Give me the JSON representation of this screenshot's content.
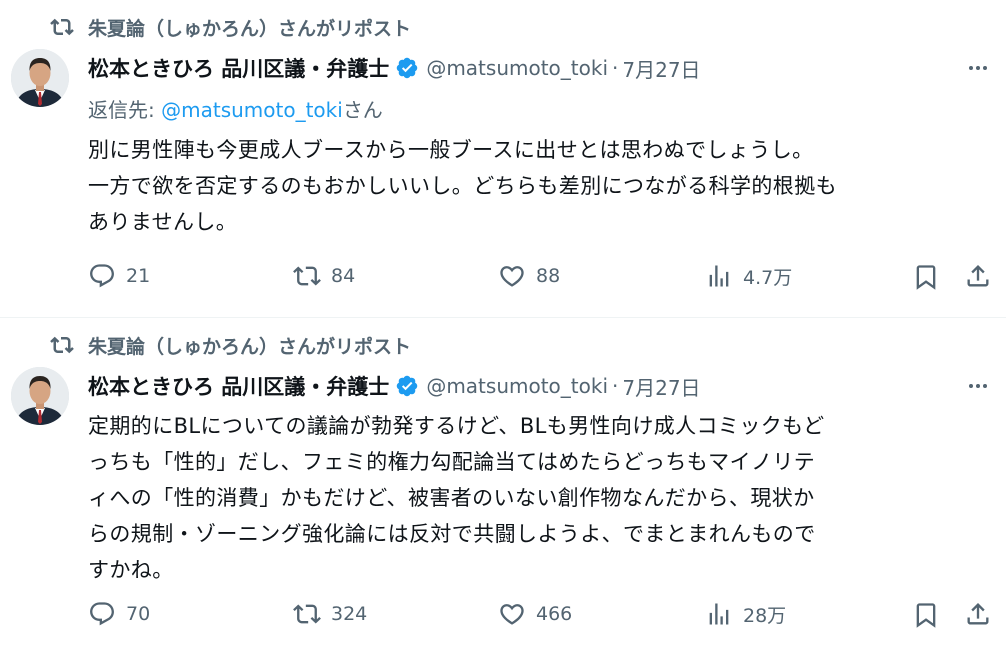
{
  "colors": {
    "accent": "#1d9bf0",
    "text": "#0f1419",
    "muted": "#536471",
    "divider": "#eff3f4"
  },
  "icons": {
    "repost": "repost-icon",
    "verified": "verified-badge-icon",
    "more": "more-icon",
    "reply": "reply-icon",
    "like": "like-icon",
    "views": "views-icon",
    "bookmark": "bookmark-icon",
    "share": "share-icon"
  },
  "tweets": [
    {
      "repost_label": "朱夏論（しゅかろん）さんがリポスト",
      "author_name": "松本ときひろ 品川区議・弁護士",
      "handle": "@matsumoto_toki",
      "separator": "·",
      "date": "7月27日",
      "reply_prefix": "返信先: ",
      "reply_handle": "@matsumoto_toki",
      "reply_suffix": "さん",
      "lines": [
        "別に男性陣も今更成人ブースから一般ブースに出せとは思わぬでしょうし。",
        "一方で欲を否定するのもおかしいいし。どちらも差別につながる科学的根拠も",
        "ありませんし。"
      ],
      "replies": "21",
      "reposts": "84",
      "likes": "88",
      "views": "4.7万"
    },
    {
      "repost_label": "朱夏論（しゅかろん）さんがリポスト",
      "author_name": "松本ときひろ 品川区議・弁護士",
      "handle": "@matsumoto_toki",
      "separator": "·",
      "date": "7月27日",
      "lines": [
        "定期的にBLについての議論が勃発するけど、BLも男性向け成人コミックもど",
        "っちも「性的」だし、フェミ的権力勾配論当てはめたらどっちもマイノリテ",
        "ィへの「性的消費」かもだけど、被害者のいない創作物なんだから、現状か",
        "らの規制・ゾーニング強化論には反対で共闘しようよ、でまとまれんもので",
        "すかね。"
      ],
      "replies": "70",
      "reposts": "324",
      "likes": "466",
      "views": "28万"
    }
  ]
}
